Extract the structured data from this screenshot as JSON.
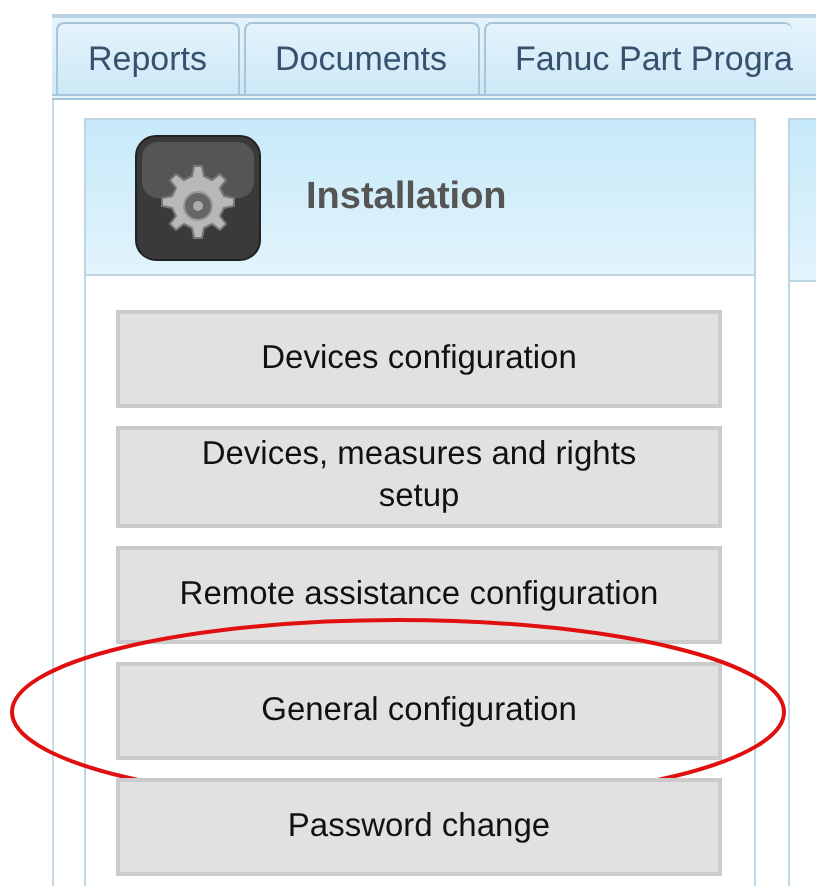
{
  "tabs": [
    {
      "label": "Reports",
      "selected": false
    },
    {
      "label": "Documents",
      "selected": false
    },
    {
      "label": "Fanuc Part Progra",
      "selected": false
    }
  ],
  "panel": {
    "title": "Installation",
    "buttons": [
      {
        "label": "Devices configuration",
        "highlighted": false
      },
      {
        "label": "Devices, measures and rights setup",
        "highlighted": false
      },
      {
        "label": "Remote assistance configuration",
        "highlighted": false
      },
      {
        "label": "General configuration",
        "highlighted": true
      },
      {
        "label": "Password change",
        "highlighted": false
      }
    ]
  }
}
